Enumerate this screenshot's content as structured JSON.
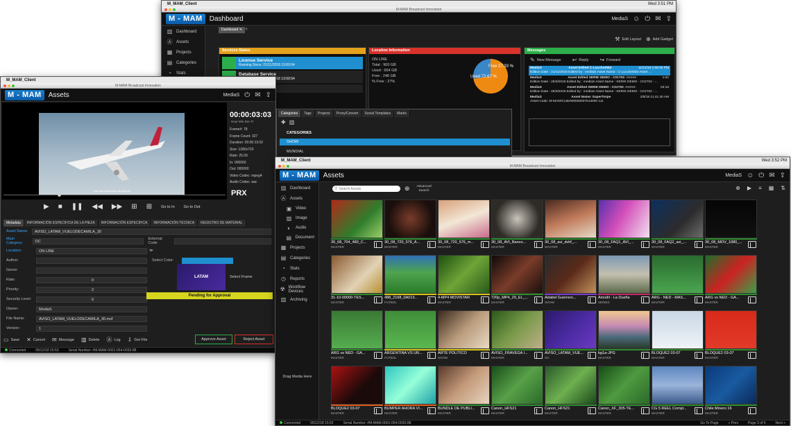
{
  "dashboard": {
    "mac_app": "M_MAM_Client",
    "mac_time": "Wed 3:51 PM",
    "window_title": "M-MAM Broadcast Innovation",
    "logo": "M - MAM",
    "page_title": "Dashboard",
    "user": "MediaS",
    "tab": "Dashboard",
    "edit_layout": "Edit Layout",
    "add_gadget": "Add Gadget",
    "sidebar": [
      "Dashboard",
      "Assets",
      "Projects",
      "Categories",
      "Stats"
    ],
    "services": {
      "title": "Services States",
      "items": [
        {
          "name": "License Service",
          "since": "Running Since :21/11/2018 13:00:54"
        },
        {
          "name": "Database Service",
          "since": "Running Since :21/11/2018 13:00:54"
        },
        {
          "name": "File Service",
          "since": ""
        }
      ]
    },
    "location": {
      "title": "Location Information",
      "status": "ON LINE",
      "total": "Total : 900 GB",
      "used": "Used : 654 GB",
      "free": "Free : 246 GB",
      "pfree": "% Free : 27%",
      "pie_free": "Free 27.33 %",
      "pie_used": "Used 72.67 %",
      "pie_free_value": 27.33,
      "pie_used_value": 72.67
    },
    "messages": {
      "title": "Messages",
      "new": "New Message",
      "reply": "Reply",
      "forward": "Forward",
      "items": [
        {
          "from": "MediaS",
          "subject": "Asset Edited C-Lucchetti63",
          "date": "11/21/18 1:06:05 PM",
          "body": "Edition Date : 21/11/2018  Edited by : mediaS  Asset Name : C-Lucchetti63  Asset ..."
        },
        {
          "from": "MediaS",
          "subject": "Asset Edited SERIE DEMO - C01T02 ->>>>>",
          "date": "1:02",
          "body": "Edition Date : 26/3/2018  Edited by : mediaS  Asset Name : SERIE DEMO - C01T02 - ..."
        },
        {
          "from": "MediaS",
          "subject": "Asset Edited SERIE DEMO - C01T02 ->>>>>",
          "date": "03:15",
          "body": "Edition Date : 26/3/2018  Edited by : mediaS  Asset Name : SERIE DEMO - C01T02 - ..."
        },
        {
          "from": "MediaS",
          "subject": "Asset Name: SuperTorpe",
          "date": "2/8/18 11:41:40 AM",
          "body": "Asset Code: M-MAM/Code000000007513000  111"
        }
      ]
    }
  },
  "assetwin": {
    "mac_app": "M_MAM_Client",
    "mac_time": "Wed 3:53 PM",
    "window_title": "M-MAM Broadcast Innovation",
    "logo": "M - MAM",
    "page_title": "Assets",
    "user": "MediaS",
    "timecode": "00:00:03:03",
    "tc_units": "Hour   Min   Sec   Fr",
    "info": [
      "Frame#: 78",
      "Frame Count: 327",
      "Duration: 00:00:13:02",
      "Size: 1280x720",
      "Rate: 25.00",
      "In: 000000",
      "Out: 000000",
      "Video Codec: mpeg4",
      "Audio Codec: aac"
    ],
    "proxy": "PRX",
    "subtitle": "Tus vida está fuela lua sayella",
    "go_in": "Go to In",
    "go_out": "Go to Out",
    "tabs": [
      "Categories",
      "Tags",
      "Projects",
      "Proxy/Convert",
      "Social Templates",
      "Marks"
    ],
    "cat_header": "CATEGORIES",
    "categories": [
      "SHOW",
      "MUNDIAL"
    ],
    "meta_tabs": [
      "Metadata",
      "INFORMACIÓN ESPECIFICA DE LA PIEZA",
      "INFORMACIÓN ESPECIFICA",
      "INFORMACIÓN TÉCNICA",
      "REGISTRO DE MATERIAL"
    ],
    "fields": {
      "asset_name_l": "Asset Name:",
      "asset_name": "AVISO_LATAM_VUELODECAMILA_30",
      "main_cat_l": "Main Category:",
      "main_cat": "OC",
      "external_l": "External Code",
      "location_l": "Location:",
      "location": "ON LINE",
      "author_l": "Author:",
      "genre_l": "Genre:",
      "rate_l": "Rate:",
      "rate": "0",
      "priority_l": "Priority:",
      "priority": "2",
      "security_l": "Security Level:",
      "security": "0",
      "owner_l": "Owner:",
      "owner": "MediaS",
      "file_l": "File Name:",
      "file": "AVISO_LATAM_VUELODECAMILA_30.mxf",
      "version_l": "Version:",
      "version": "1",
      "color_l": "Select Color:",
      "frame_l": "Select Frame",
      "latam": "LATAM",
      "pending": "Pending for Approval"
    },
    "actions": [
      "Save",
      "Cancel",
      "Message",
      "Delete",
      "Log",
      "Get File"
    ],
    "approve": "Approve Asset",
    "reject": "Reject Asset",
    "status": {
      "connected": "Connected",
      "date": "05/12/18 15:53",
      "serial": "Serial Number: #M-MAM-0001-054-0033-88"
    }
  },
  "assets": {
    "mac_app": "M_MAM_Client",
    "mac_time": "Wed 3:52 PM",
    "window_title": "M-MAM Broadcast Innovation",
    "logo": "M - MAM",
    "page_title": "Assets",
    "user": "MediaS",
    "search_placeholder": "Search Assets",
    "advanced": "Advanced Search",
    "sidebar": [
      {
        "label": "Dashboard",
        "icon": "chart",
        "sub": false
      },
      {
        "label": "Assets",
        "icon": "A",
        "sub": false
      },
      {
        "label": "Video",
        "icon": "film",
        "sub": true
      },
      {
        "label": "Image",
        "icon": "image",
        "sub": true
      },
      {
        "label": "Audio",
        "icon": "audio",
        "sub": true
      },
      {
        "label": "Document",
        "icon": "doc",
        "sub": true
      },
      {
        "label": "Projects",
        "icon": "projects",
        "sub": false
      },
      {
        "label": "Categories",
        "icon": "categories",
        "sub": false
      },
      {
        "label": "Stats",
        "icon": "stats",
        "sub": false
      },
      {
        "label": "Reports",
        "icon": "reports",
        "sub": false
      },
      {
        "label": "Workflow Devices",
        "icon": "workflow",
        "sub": false
      },
      {
        "label": "Archiving",
        "icon": "archive",
        "sub": false
      }
    ],
    "drag": "Drag Media Here",
    "tiles": [
      {
        "name": "30_08_704_480_C...",
        "cat": "MASTER",
        "color": "#2e8b2e",
        "bg": "linear-gradient(135deg,#b12a1a,#2f7d2c 60%,#9ccf6a)"
      },
      {
        "name": "30_08_720_576_A...",
        "cat": "MASTER",
        "color": "#2e8b2e",
        "bg": "radial-gradient(circle at 50% 50%,#7a3c2a,#1a0f0c 70%)"
      },
      {
        "name": "30_08_720_576_m...",
        "cat": "MASTER",
        "color": "#2e8b2e",
        "bg": "linear-gradient(160deg,#d8a07a,#f2e7d6 50%,#c86b8a)"
      },
      {
        "name": "30_08_AVI_Banco...",
        "cat": "MASTER",
        "color": "#2e8b2e",
        "bg": "radial-gradient(circle at 50% 50%,#c8c4bb,#2e2a26 70%)"
      },
      {
        "name": "30_08_avi_dvhf_...",
        "cat": "MASTER",
        "color": "#2e8b2e",
        "bg": "linear-gradient(160deg,#4b2a1e,#c07a5a 50%,#e6d9c6)"
      },
      {
        "name": "30_08_FAQ1_AVI_...",
        "cat": "MASTER",
        "color": "#2e8b2e",
        "bg": "linear-gradient(120deg,#5a2fae,#d44fb9 45%,#f2e0f0)"
      },
      {
        "name": "30_08_FAQ2_avi_...",
        "cat": "MASTER",
        "color": "#2e8b2e",
        "bg": "linear-gradient(135deg,#0c2f5f,#2c2c2c 60%,#6c6c6c)"
      },
      {
        "name": "30_08_MOV_1080_...",
        "cat": "MASTER",
        "color": "#2e8b2e",
        "bg": "linear-gradient(#050505,#101010)"
      },
      {
        "name": "31-10-00000-TES...",
        "cat": "MASTER",
        "color": "#2e8b2e",
        "bg": "linear-gradient(135deg,#8a5a30,#e2d2b6 60%,#b7902f)"
      },
      {
        "name": "488_2168_0A013...",
        "cat": "FUTBOL",
        "color": "#d8c619",
        "bg": "linear-gradient(#2e6fb5,#4fa54f 45%,#2b7b2b)"
      },
      {
        "name": "4-MP4 MOVISTAR",
        "cat": "MASTER",
        "color": "#d8c619",
        "bg": "linear-gradient(135deg,#1f4f12,#6ea437 50%,#2a5a1a)"
      },
      {
        "name": "720p_MP4_29_EL_...",
        "cat": "MASTER",
        "color": "#2e8b2e",
        "bg": "linear-gradient(135deg,#0e0a09,#7a3c2a 50%,#1a0f0c)"
      },
      {
        "name": "Adabel Guerrero...",
        "cat": "SHOW",
        "color": "#7a3ac9",
        "bg": "linear-gradient(135deg,#2a2a2a,#5a2a1a 50%,#c1915a)"
      },
      {
        "name": "Amodil - La Dueña",
        "cat": "SERIES",
        "color": "#c42a6a",
        "bg": "linear-gradient(#7c98b4,#c4c0b0 50%,#5c6a4a)"
      },
      {
        "name": "ARG - NED - MAS...",
        "cat": "MASTER",
        "color": "#2e8b2e",
        "bg": "linear-gradient(#2a6b2f,#4aa54f)"
      },
      {
        "name": "ARG vs NED - GA...",
        "cat": "MASTER",
        "color": "#2e8b2e",
        "bg": "linear-gradient(135deg,#1d6f2a,#c22 50%,#3aa04a)"
      },
      {
        "name": "ARG vs NED - GA...",
        "cat": "MASTER",
        "color": "#2e8b2e",
        "bg": "linear-gradient(#3a7a34,#56ad50)"
      },
      {
        "name": "ARGENTINA VS UR...",
        "cat": "FUTBOL",
        "color": "#d8c619",
        "bg": "linear-gradient(#3f8d3a,#5ab84f)"
      },
      {
        "name": "ARTE POLITICO",
        "cat": "SHOW",
        "color": "#d8c619",
        "bg": "linear-gradient(135deg,#3a2a1e,#b89a7a 50%,#e9dac4)"
      },
      {
        "name": "AVISO_FRAVEGA I...",
        "cat": "MASTER",
        "color": "#2e8b2e",
        "bg": "linear-gradient(135deg,#2a5a1a,#7a9a4a 50%,#bfae8a)"
      },
      {
        "name": "AVISO_LATAM_VUE...",
        "cat": "OC",
        "color": "#2e8b2e",
        "bg": "linear-gradient(135deg,#2a1a6a,#4a2aa0 50%,#6a3ac0)"
      },
      {
        "name": "bg1a-JPG",
        "cat": "MASTER",
        "color": "#2e8b2e",
        "bg": "linear-gradient(#f0c890,#c68ab2 40%,#4a6a7a 70%,#2a3a2a)"
      },
      {
        "name": "BLOQUE2 03-07",
        "cat": "MASTER",
        "color": "#2e8b2e",
        "bg": "linear-gradient(#c9d7e6,#eef3f7)"
      },
      {
        "name": "BLOQUE2 03-07",
        "cat": "MASTER",
        "color": "#2e8b2e",
        "bg": "linear-gradient(#d82a1a,#e23a2a)"
      },
      {
        "name": "BLOQUE2 03-07",
        "cat": "MASTER",
        "color": "#e05a1a",
        "bg": "linear-gradient(135deg,#ab1212,#1a0a0a 60%)"
      },
      {
        "name": "BUMPER AHORA VI...",
        "cat": "MASTER",
        "color": "#e05a1a",
        "bg": "linear-gradient(135deg,#2ec6c0,#96ffd8 50%,#1fa0a6)"
      },
      {
        "name": "BUNDLE DE PUBLI...",
        "cat": "MASTER",
        "color": "#2e8b2e",
        "bg": "linear-gradient(135deg,#5a3a2a,#c49a7a 50%,#e6d4c0)"
      },
      {
        "name": "Canon_HFS21",
        "cat": "MASTER",
        "color": "#2e8b2e",
        "bg": "linear-gradient(135deg,#1a4f1a,#58a048 50%,#2a6a2a)"
      },
      {
        "name": "Canon_HFS21",
        "cat": "MASTER",
        "color": "#2e8b2e",
        "bg": "linear-gradient(135deg,#2a5a2a,#6eb050 50%,#1a4a1a)"
      },
      {
        "name": "Canon_XF_305-TE...",
        "cat": "MASTER",
        "color": "#2e8b2e",
        "bg": "linear-gradient(135deg,#164d16,#4f9a40 50%,#2a6a2a)"
      },
      {
        "name": "CG 5 REEL Compl...",
        "cat": "MASTER",
        "color": "#2e8b2e",
        "bg": "linear-gradient(#5d86c0,#9ab4da 50%,#3a5a8a)"
      },
      {
        "name": "Chile Minero 16",
        "cat": "MASTER",
        "color": "#2e8b2e",
        "bg": "linear-gradient(135deg,#0a3a7a,#1a5aa0 50%,#0a2a5a)"
      }
    ],
    "status": {
      "connected": "Connected",
      "date": "05/12/18 15:52",
      "serial": "Serial Number: #M-MAM-0001-054-0033-88",
      "goto": "Go To Page",
      "prev": "« Prev",
      "page": "Page 3 of 5",
      "next": "Next »"
    }
  }
}
